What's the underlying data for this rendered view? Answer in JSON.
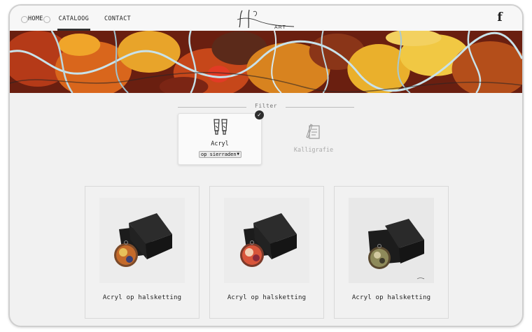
{
  "nav": {
    "links": [
      {
        "label": "HOME"
      },
      {
        "label": "CATALOOG"
      },
      {
        "label": "CONTACT"
      }
    ],
    "active": "CATALOOG",
    "facebook_glyph": "f"
  },
  "logo": {
    "text": "H ART"
  },
  "filter": {
    "label": "Filter",
    "categories": [
      {
        "name": "Acryl",
        "selected": true,
        "select_value": "op sierraden",
        "icon": "paint-tubes-icon"
      },
      {
        "name": "Kalligrafie",
        "selected": false,
        "icon": "calligraphy-icon"
      }
    ]
  },
  "products": [
    {
      "title": "Acryl op halsketting"
    },
    {
      "title": "Acryl op halsketting"
    },
    {
      "title": "Acryl op halsketting"
    }
  ],
  "colors": {
    "background": "#f1f1f1",
    "navbar": "#f7f7f7",
    "text": "#222222",
    "accent": "#2f2f2f"
  }
}
